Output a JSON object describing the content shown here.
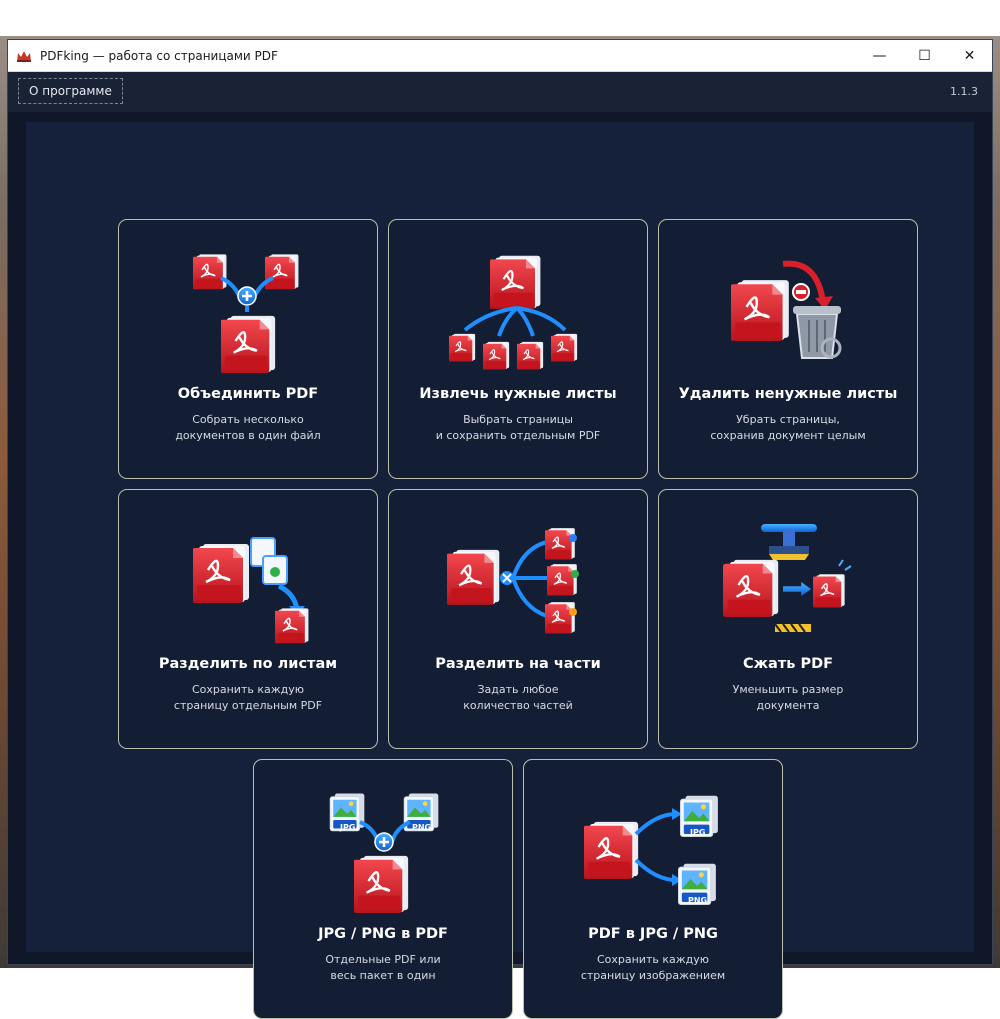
{
  "window": {
    "title": "PDFking — работа со страницами PDF",
    "controls": {
      "minimize": "—",
      "maximize": "☐",
      "close": "✕"
    }
  },
  "menu": {
    "about_label": "О программе",
    "version": "1.1.3"
  },
  "cards": [
    {
      "icon": "merge-pdf-icon",
      "title": "Объединить PDF",
      "desc1": "Собрать несколько",
      "desc2": "документов в один файл"
    },
    {
      "icon": "extract-pages-icon",
      "title": "Извлечь нужные листы",
      "desc1": "Выбрать страницы",
      "desc2": "и сохранить отдельным PDF"
    },
    {
      "icon": "delete-pages-icon",
      "title": "Удалить ненужные листы",
      "desc1": "Убрать страницы,",
      "desc2": "сохранив документ целым"
    },
    {
      "icon": "split-pages-icon",
      "title": "Разделить по листам",
      "desc1": "Сохранить каждую",
      "desc2": "страницу отдельным PDF"
    },
    {
      "icon": "split-parts-icon",
      "title": "Разделить на части",
      "desc1": "Задать любое",
      "desc2": "количество частей"
    },
    {
      "icon": "compress-pdf-icon",
      "title": "Сжать PDF",
      "desc1": "Уменьшить размер",
      "desc2": "документа"
    },
    {
      "icon": "images-to-pdf-icon",
      "title": "JPG / PNG в PDF",
      "desc1": "Отдельные PDF или",
      "desc2": "весь пакет в один"
    },
    {
      "icon": "pdf-to-images-icon",
      "title": "PDF в JPG / PNG",
      "desc1": "Сохранить каждую",
      "desc2": "страницу изображением"
    }
  ],
  "icon_labels": {
    "pdf": "PDF",
    "jpg": "JPG",
    "png": "PNG"
  },
  "colors": {
    "accent_red": "#d8202a",
    "arrow_blue": "#1f8fff",
    "card_bg": "#131d33",
    "card_border": "#b9bfa8"
  }
}
